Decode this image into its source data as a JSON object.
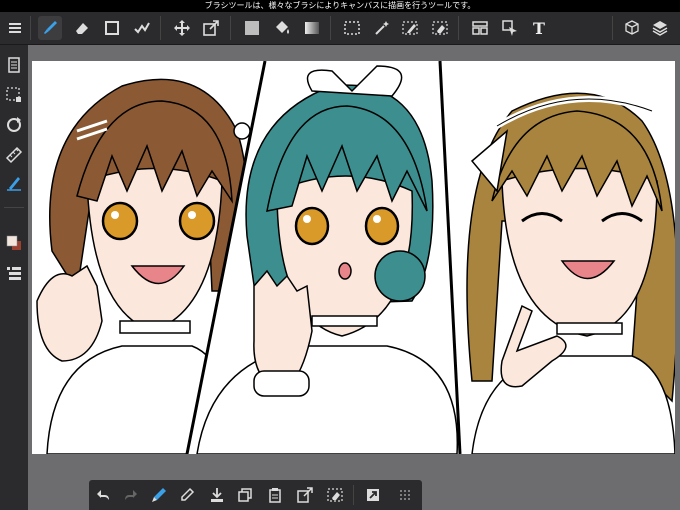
{
  "status_bar": {
    "message": "ブラシツールは、様々なブラシによりキャンバスに描画を行うツールです。"
  },
  "toolbar": {
    "text_tool_label": "T",
    "tools": [
      "menu-icon",
      "brush-icon",
      "eraser-icon",
      "shape-icon",
      "auto-select-icon",
      "move-icon",
      "transform-icon",
      "fill-color-icon",
      "bucket-icon",
      "gradient-icon",
      "selection-rect-icon",
      "magic-wand-icon",
      "select-pen-icon",
      "select-eraser-icon",
      "frame-icon",
      "operation-icon",
      "text-icon",
      "3d-material-icon",
      "layers-icon"
    ],
    "active_tool": "brush-icon"
  },
  "sidebar": {
    "items": [
      "pages-icon",
      "selection-icon",
      "rotate-icon",
      "ruler-icon",
      "snap-icon",
      "color-swatch",
      "layer-panel-icon"
    ],
    "colors": {
      "main": "#f3e6dc",
      "sub": "#9a4130"
    }
  },
  "canvas": {
    "description_colors": {
      "hair_left": "#8b5a34",
      "hair_center": "#3d8f8f",
      "hair_right": "#a8843f",
      "skin": "#fbe7dc",
      "outline": "#000000"
    }
  },
  "bottom_toolbar": {
    "items": [
      "undo-icon",
      "redo-icon",
      "brush-edit-icon",
      "eyedropper-icon",
      "import-icon",
      "copy-icon",
      "paste-icon",
      "transform-bb-icon",
      "clear-icon",
      "quick-access-icon",
      "grid-menu-icon"
    ]
  }
}
